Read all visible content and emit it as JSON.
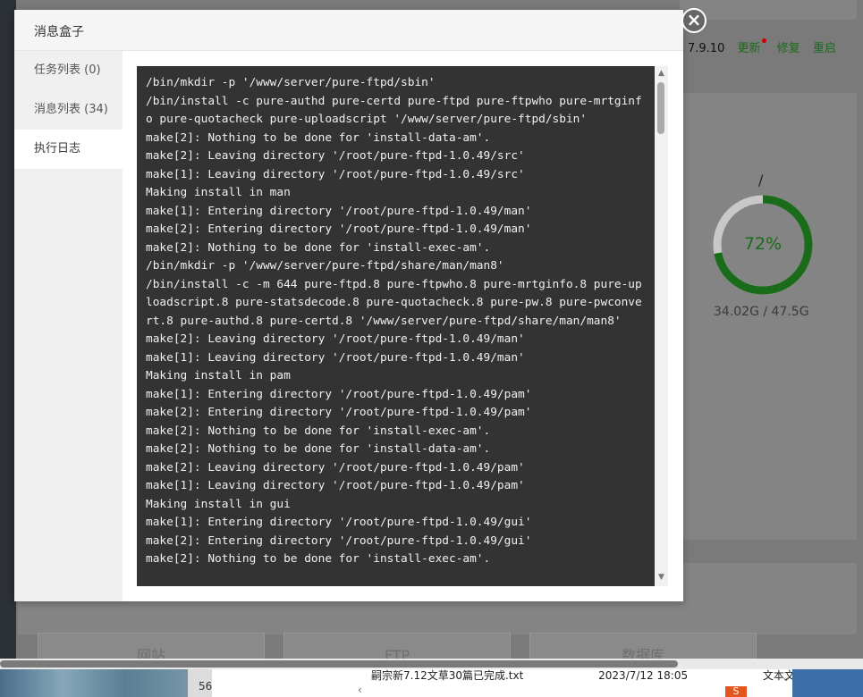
{
  "background": {
    "version": "7.9.10",
    "links": [
      "更新",
      "修复",
      "重启"
    ],
    "disk": {
      "mount": "/",
      "percent": "72%",
      "percent_value": 0.72,
      "usage": "34.02G / 47.5G"
    },
    "cards": [
      "网站",
      "FTP",
      "数据库"
    ]
  },
  "taskbar": {
    "number": "56",
    "file_name": "嗣宗新7.12文草30篇已完成.txt",
    "file_date": "2023/7/12 18:05",
    "file_type": "文本文档",
    "logo": "S"
  },
  "modal": {
    "title": "消息盒子",
    "close_label": "×",
    "tabs": [
      "任务列表 (0)",
      "消息列表 (34)",
      "执行日志"
    ],
    "active_tab": 2,
    "log": "/bin/mkdir -p '/www/server/pure-ftpd/sbin'\n/bin/install -c pure-authd pure-certd pure-ftpd pure-ftpwho pure-mrtginfo pure-quotacheck pure-uploadscript '/www/server/pure-ftpd/sbin'\nmake[2]: Nothing to be done for 'install-data-am'.\nmake[2]: Leaving directory '/root/pure-ftpd-1.0.49/src'\nmake[1]: Leaving directory '/root/pure-ftpd-1.0.49/src'\nMaking install in man\nmake[1]: Entering directory '/root/pure-ftpd-1.0.49/man'\nmake[2]: Entering directory '/root/pure-ftpd-1.0.49/man'\nmake[2]: Nothing to be done for 'install-exec-am'.\n/bin/mkdir -p '/www/server/pure-ftpd/share/man/man8'\n/bin/install -c -m 644 pure-ftpd.8 pure-ftpwho.8 pure-mrtginfo.8 pure-uploadscript.8 pure-statsdecode.8 pure-quotacheck.8 pure-pw.8 pure-pwconvert.8 pure-authd.8 pure-certd.8 '/www/server/pure-ftpd/share/man/man8'\nmake[2]: Leaving directory '/root/pure-ftpd-1.0.49/man'\nmake[1]: Leaving directory '/root/pure-ftpd-1.0.49/man'\nMaking install in pam\nmake[1]: Entering directory '/root/pure-ftpd-1.0.49/pam'\nmake[2]: Entering directory '/root/pure-ftpd-1.0.49/pam'\nmake[2]: Nothing to be done for 'install-exec-am'.\nmake[2]: Nothing to be done for 'install-data-am'.\nmake[2]: Leaving directory '/root/pure-ftpd-1.0.49/pam'\nmake[1]: Leaving directory '/root/pure-ftpd-1.0.49/pam'\nMaking install in gui\nmake[1]: Entering directory '/root/pure-ftpd-1.0.49/gui'\nmake[2]: Entering directory '/root/pure-ftpd-1.0.49/gui'\nmake[2]: Nothing to be done for 'install-exec-am'."
  },
  "colors": {
    "accent_green": "#1a6b1a",
    "log_bg": "#333333",
    "ring_track": "#c8c8c8"
  }
}
